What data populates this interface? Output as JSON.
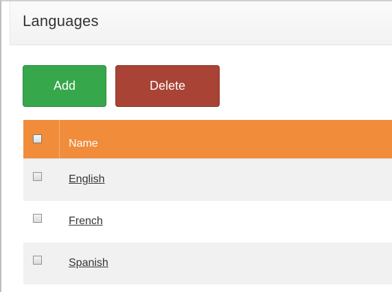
{
  "panel": {
    "title": "Languages"
  },
  "toolbar": {
    "add_label": "Add",
    "delete_label": "Delete"
  },
  "grid": {
    "columns": {
      "name": "Name"
    },
    "rows": [
      {
        "name": "English",
        "selected": false
      },
      {
        "name": "French",
        "selected": false
      },
      {
        "name": "Spanish",
        "selected": false
      }
    ]
  },
  "colors": {
    "add_button": "#36a74a",
    "delete_button": "#a84335",
    "header_accent": "#f08c3a",
    "alt_row": "#f1f1f1"
  }
}
